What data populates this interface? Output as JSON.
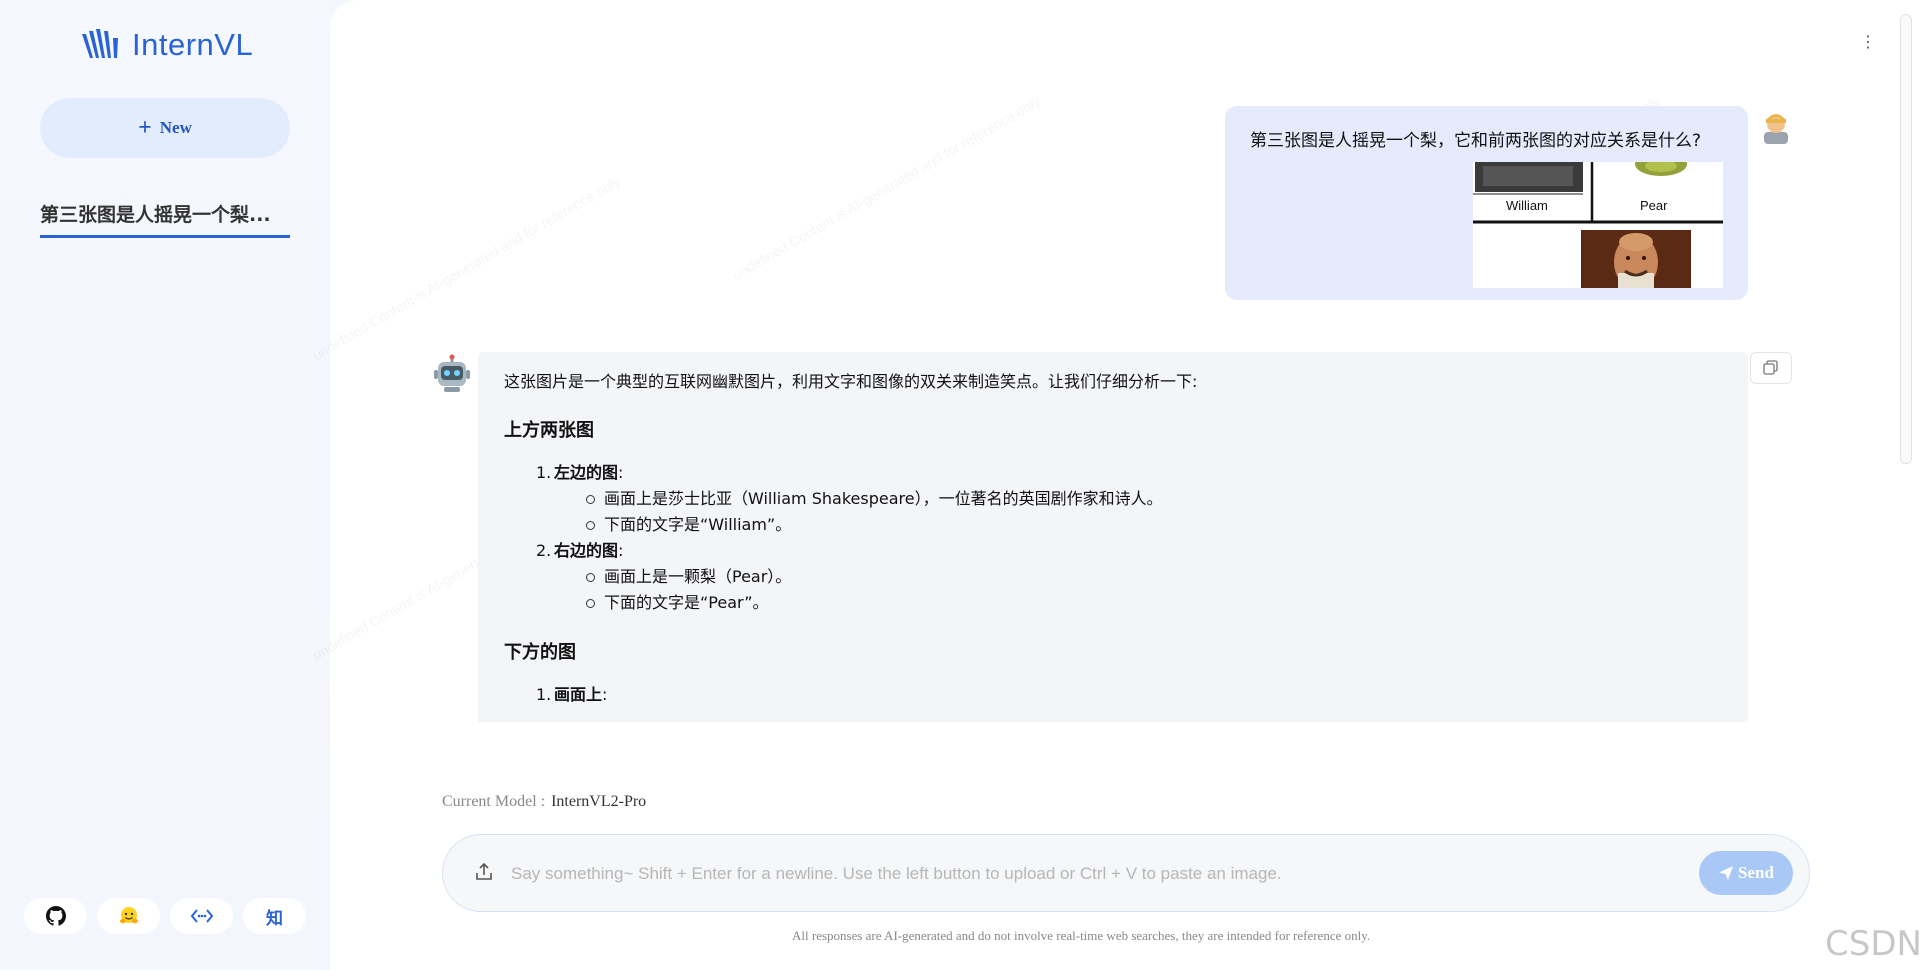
{
  "app": {
    "logo_text": "InternVL",
    "brand_color": "#2a63d6"
  },
  "sidebar": {
    "new_button_label": "New",
    "history": [
      {
        "title": "第三张图是人摇晃一个梨..."
      }
    ],
    "footer_icons": [
      {
        "name": "github-icon",
        "glyph": ""
      },
      {
        "name": "huggingface-icon",
        "glyph": ""
      },
      {
        "name": "code-icon",
        "glyph": ""
      },
      {
        "name": "zhihu-icon",
        "glyph": "知"
      }
    ]
  },
  "chat": {
    "user_message": {
      "text": "第三张图是人摇晃一个梨，它和前两张图的对应关系是什么?",
      "image": {
        "label_left": "William",
        "label_right": "Pear"
      }
    },
    "bot_message": {
      "intro": "这张图片是一个典型的互联网幽默图片，利用文字和图像的双关来制造笑点。让我们仔细分析一下:",
      "section1_title": "上方两张图",
      "item1_num": "1.",
      "item1_title": "左边的图",
      "item1_colon": ":",
      "item1_b1": "画面上是莎士比亚（William Shakespeare），一位著名的英国剧作家和诗人。",
      "item1_b2": "下面的文字是“William”。",
      "item2_num": "2.",
      "item2_title": "右边的图",
      "item2_colon": ":",
      "item2_b1": "画面上是一颗梨（Pear）。",
      "item2_b2": "下面的文字是“Pear”。",
      "section2_title": "下方的图",
      "item3_num": "1.",
      "item3_title": "画面上",
      "item3_colon": ":"
    },
    "watermark_text": "undefined Content is AI-generated and for reference only"
  },
  "composer": {
    "current_model_label": "Current Model :",
    "current_model_value": "InternVL2-Pro",
    "placeholder": "Say something~ Shift + Enter for a newline. Use the left button to upload or Ctrl + V to paste an image.",
    "send_label": "Send",
    "disclaimer": "All responses are AI-generated and do not involve real-time web searches, they are intended for reference only."
  },
  "overlay": {
    "csdn_watermark": "CSDN @最是人间留不住_"
  }
}
